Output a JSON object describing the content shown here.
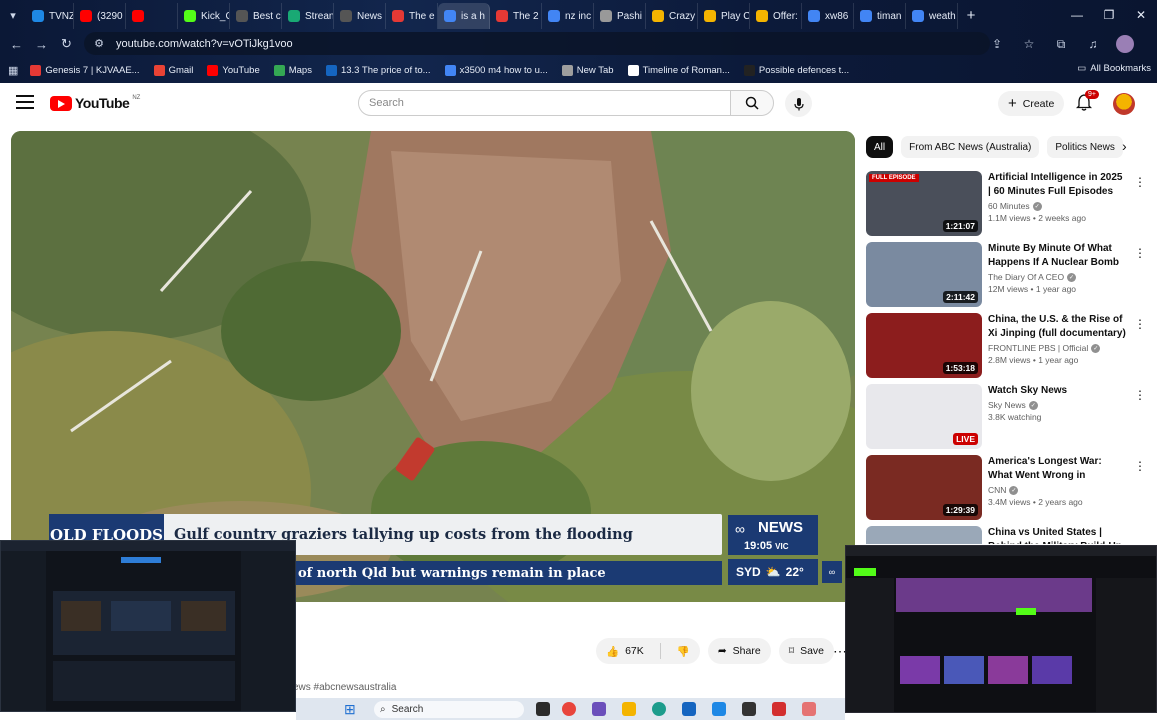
{
  "browser": {
    "tabs": [
      {
        "label": "TVNZ",
        "color": "#1e88e5"
      },
      {
        "label": "(3290",
        "color": "#ff0000"
      },
      {
        "label": "",
        "color": "#ff0000"
      },
      {
        "label": "Kick_C",
        "color": "#53fc18"
      },
      {
        "label": "Best c",
        "color": "#555555"
      },
      {
        "label": "Strean",
        "color": "#19a974"
      },
      {
        "label": "News",
        "color": "#555555"
      },
      {
        "label": "The e",
        "color": "#e53935"
      },
      {
        "label": "is a h",
        "color": "#4285f4"
      },
      {
        "label": "The 2",
        "color": "#e53935"
      },
      {
        "label": "nz inc",
        "color": "#4285f4"
      },
      {
        "label": "Pashi",
        "color": "#999999"
      },
      {
        "label": "Crazy",
        "color": "#f4b400"
      },
      {
        "label": "Play C",
        "color": "#f4b400"
      },
      {
        "label": "Offer:",
        "color": "#f4b400"
      },
      {
        "label": "xw86",
        "color": "#4285f4"
      },
      {
        "label": "timan",
        "color": "#4285f4"
      },
      {
        "label": "weath",
        "color": "#4285f4"
      }
    ],
    "url": "youtube.com/watch?v=vOTiJkg1voo",
    "bookmarks": [
      {
        "label": "Genesis 7 | KJVAAE...",
        "color": "#e53935"
      },
      {
        "label": "Gmail",
        "color": "#ea4335"
      },
      {
        "label": "YouTube",
        "color": "#ff0000"
      },
      {
        "label": "Maps",
        "color": "#34a853"
      },
      {
        "label": "13.3 The price of to...",
        "color": "#1565c0"
      },
      {
        "label": "x3500 m4 how to u...",
        "color": "#4285f4"
      },
      {
        "label": "New Tab",
        "color": "#9e9e9e"
      },
      {
        "label": "Timeline of Roman...",
        "color": "#ffffff"
      },
      {
        "label": "Possible defences t...",
        "color": "#222222"
      }
    ],
    "all_bookmarks": "All Bookmarks"
  },
  "youtube": {
    "logo": "YouTube",
    "country": "NZ",
    "search_placeholder": "Search",
    "create_label": "Create",
    "notif_badge": "9+"
  },
  "video": {
    "lower_third_tag": "QLD FLOODS",
    "headline": "Gulf country graziers tallying up costs from the flooding",
    "subline": "of north Qld but warnings remain in place",
    "network": "NEWS",
    "time": "19:05",
    "timezone": "VIC",
    "city": "SYD",
    "temp": "22°"
  },
  "actions": {
    "likes": "67K",
    "share": "Share",
    "save": "Save"
  },
  "hashtag": "ews #abcnewsaustralia",
  "chips": [
    "All",
    "From ABC News (Australia)",
    "Politics News"
  ],
  "recommendations": [
    {
      "title": "Artificial Intelligence in 2025 | 60 Minutes Full Episodes",
      "channel": "60 Minutes",
      "stats": "1.1M views • 2 weeks ago",
      "duration": "1:21:07",
      "tag": "FULL EPISODE",
      "thumb": "#4a4f5a"
    },
    {
      "title": "Minute By Minute Of What Happens If A Nuclear Bomb ...",
      "channel": "The Diary Of A CEO",
      "stats": "12M views • 1 year ago",
      "duration": "2:11:42",
      "tag": "",
      "thumb": "#7a8aa0"
    },
    {
      "title": "China, the U.S. & the Rise of Xi Jinping (full documentary) | ...",
      "channel": "FRONTLINE PBS | Official",
      "stats": "2.8M views • 1 year ago",
      "duration": "1:53:18",
      "tag": "",
      "thumb": "#8c1d1d"
    },
    {
      "title": "Watch Sky News",
      "channel": "Sky News",
      "stats": "3.8K watching",
      "duration": "LIVE",
      "tag": "",
      "thumb": "#e8e8ec"
    },
    {
      "title": "America's Longest War: What Went Wrong in Afghanistan ...",
      "channel": "CNN",
      "stats": "3.4M views • 2 years ago",
      "duration": "1:29:39",
      "tag": "",
      "thumb": "#7a2a22"
    },
    {
      "title": "China vs United States | Behind the Military Build-Up",
      "channel": "",
      "stats": "",
      "duration": "",
      "tag": "",
      "thumb": "#9aa8b8"
    }
  ],
  "taskbar": {
    "search": "Search"
  }
}
